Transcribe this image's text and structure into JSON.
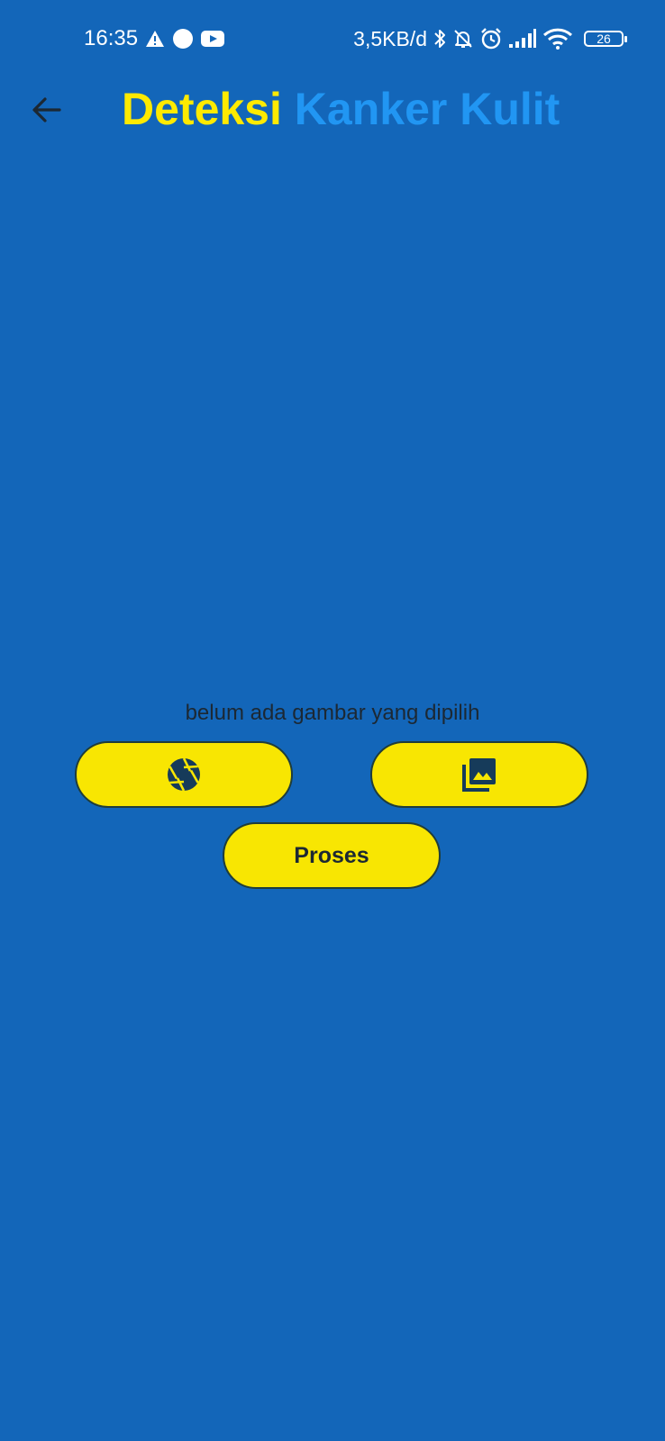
{
  "status_bar": {
    "time": "16:35",
    "network_speed": "3,5KB/d",
    "battery_level": "26",
    "left_icons": [
      "alert-triangle-icon",
      "circle-notification-icon",
      "youtube-icon"
    ],
    "right_icons": [
      "bluetooth-icon",
      "bell-off-icon",
      "alarm-icon",
      "signal-icon",
      "wifi-icon",
      "battery-icon"
    ]
  },
  "app_bar": {
    "back_icon": "arrow-left-icon",
    "title_part1": "Deteksi",
    "title_part2": "Kanker Kulit"
  },
  "main": {
    "status_text": "belum ada gambar yang dipilih",
    "camera_button_icon": "camera-aperture-icon",
    "gallery_button_icon": "photo-library-icon",
    "process_button_label": "Proses"
  },
  "colors": {
    "background": "#1366B9",
    "title_primary": "#FFEA00",
    "title_secondary": "#2196F3",
    "button_fill": "#F8E602",
    "button_border": "#1f3d3a",
    "dark_text": "#1c2833"
  }
}
